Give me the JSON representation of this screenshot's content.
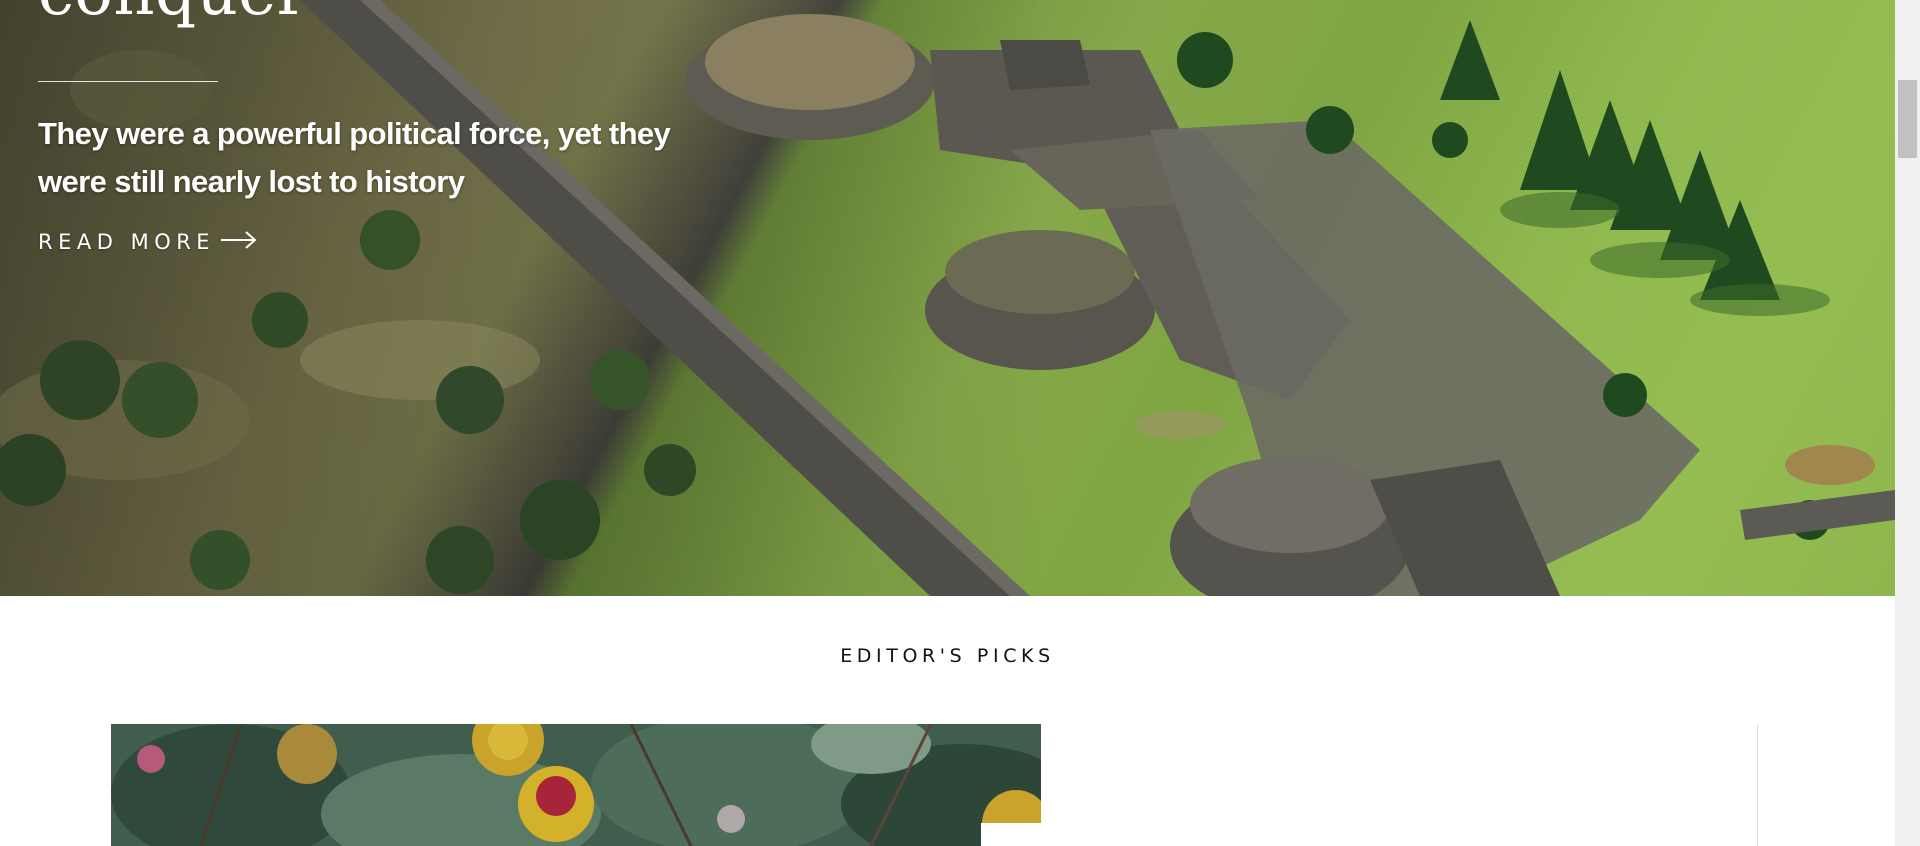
{
  "hero": {
    "title": "conquer",
    "dek": "They were a powerful political force, yet they were still nearly lost to history",
    "read_more_label": "READ MORE",
    "read_more_icon": "arrow-right-icon"
  },
  "editors_picks": {
    "heading": "EDITOR'S PICKS"
  }
}
